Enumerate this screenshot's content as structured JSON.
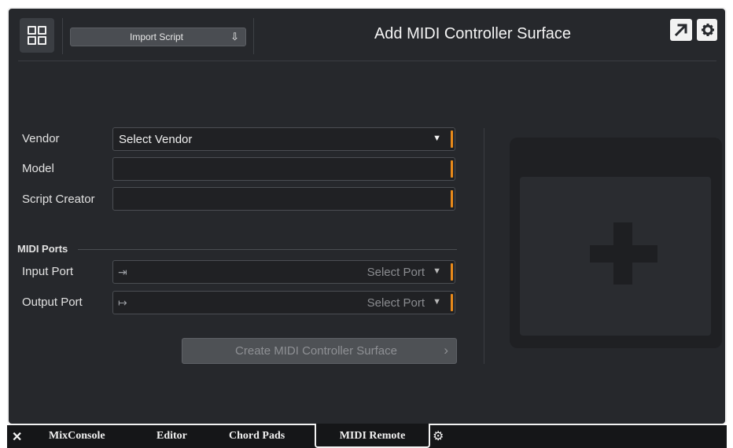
{
  "header": {
    "grid_icon": "grid-2x2-icon",
    "import_label": "Import Script",
    "import_icon": "import-tray-icon",
    "title": "Add MIDI Controller Surface",
    "expand_icon": "arrow-up-right-icon",
    "settings_icon": "gear-icon"
  },
  "form": {
    "vendor_label": "Vendor",
    "vendor_value": "Select Vendor",
    "model_label": "Model",
    "model_value": "",
    "creator_label": "Script Creator",
    "creator_value": "",
    "section_title": "MIDI Ports",
    "input_label": "Input Port",
    "input_placeholder": "Select Port",
    "input_icon": "port-in-icon",
    "output_label": "Output Port",
    "output_placeholder": "Select Port",
    "output_icon": "port-out-icon",
    "create_label": "Create MIDI Controller Surface"
  },
  "preview": {
    "icon": "plus-icon"
  },
  "tabs": [
    {
      "label": "MixConsole",
      "active": false
    },
    {
      "label": "Editor",
      "active": false
    },
    {
      "label": "Chord Pads",
      "active": false
    },
    {
      "label": "MIDI Remote",
      "active": true
    }
  ],
  "colors": {
    "background": "#26282c",
    "accent": "#e88a1a",
    "tabbar": "#151618"
  }
}
